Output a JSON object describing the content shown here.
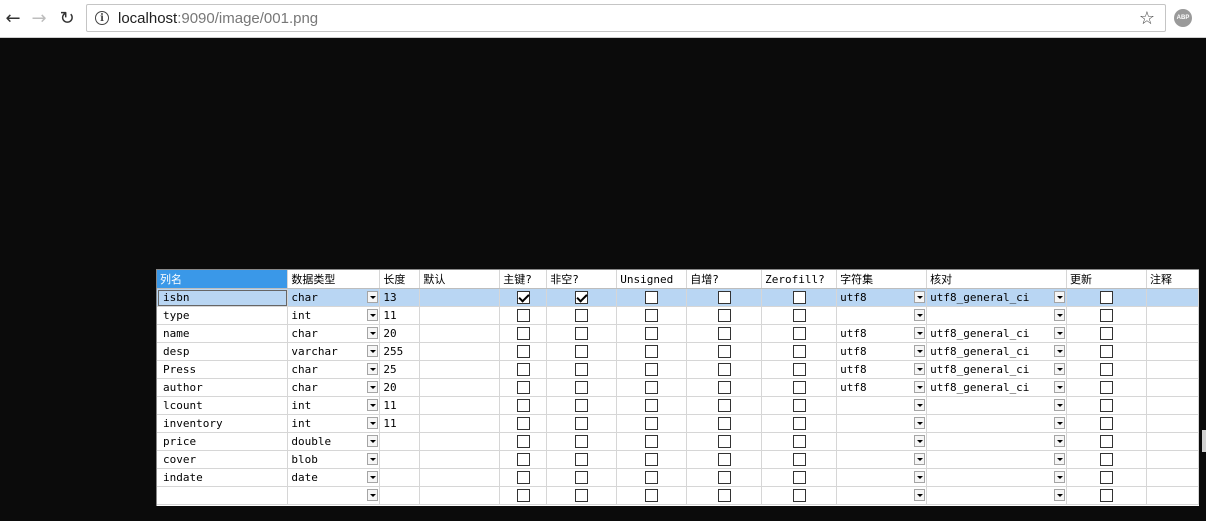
{
  "browser": {
    "url_host": "localhost",
    "url_rest": ":9090/image/001.png",
    "back_icon": "arrow-left-icon",
    "forward_icon": "arrow-right-icon",
    "reload_icon": "reload-icon",
    "info_icon": "info-icon",
    "bookmark_icon": "star-icon",
    "extension_label": "ABP"
  },
  "grid": {
    "headers": [
      "列名",
      "数据类型",
      "长度",
      "默认",
      "主键?",
      "非空?",
      "Unsigned",
      "自增?",
      "Zerofill?",
      "字符集",
      "核对",
      "更新",
      "注释"
    ],
    "rows": [
      {
        "name": "isbn",
        "type": "char",
        "length": "13",
        "default": "",
        "pk": true,
        "notnull": true,
        "unsigned": false,
        "autoinc": false,
        "zerofill": false,
        "charset": "utf8",
        "collation": "utf8_general_ci",
        "update": false,
        "comment": ""
      },
      {
        "name": "type",
        "type": "int",
        "length": "11",
        "default": "",
        "pk": false,
        "notnull": false,
        "unsigned": false,
        "autoinc": false,
        "zerofill": false,
        "charset": "",
        "collation": "",
        "update": false,
        "comment": ""
      },
      {
        "name": "name",
        "type": "char",
        "length": "20",
        "default": "",
        "pk": false,
        "notnull": false,
        "unsigned": false,
        "autoinc": false,
        "zerofill": false,
        "charset": "utf8",
        "collation": "utf8_general_ci",
        "update": false,
        "comment": ""
      },
      {
        "name": "desp",
        "type": "varchar",
        "length": "255",
        "default": "",
        "pk": false,
        "notnull": false,
        "unsigned": false,
        "autoinc": false,
        "zerofill": false,
        "charset": "utf8",
        "collation": "utf8_general_ci",
        "update": false,
        "comment": ""
      },
      {
        "name": "Press",
        "type": "char",
        "length": "25",
        "default": "",
        "pk": false,
        "notnull": false,
        "unsigned": false,
        "autoinc": false,
        "zerofill": false,
        "charset": "utf8",
        "collation": "utf8_general_ci",
        "update": false,
        "comment": ""
      },
      {
        "name": "author",
        "type": "char",
        "length": "20",
        "default": "",
        "pk": false,
        "notnull": false,
        "unsigned": false,
        "autoinc": false,
        "zerofill": false,
        "charset": "utf8",
        "collation": "utf8_general_ci",
        "update": false,
        "comment": ""
      },
      {
        "name": "lcount",
        "type": "int",
        "length": "11",
        "default": "",
        "pk": false,
        "notnull": false,
        "unsigned": false,
        "autoinc": false,
        "zerofill": false,
        "charset": "",
        "collation": "",
        "update": false,
        "comment": ""
      },
      {
        "name": "inventory",
        "type": "int",
        "length": "11",
        "default": "",
        "pk": false,
        "notnull": false,
        "unsigned": false,
        "autoinc": false,
        "zerofill": false,
        "charset": "",
        "collation": "",
        "update": false,
        "comment": ""
      },
      {
        "name": "price",
        "type": "double",
        "length": "",
        "default": "",
        "pk": false,
        "notnull": false,
        "unsigned": false,
        "autoinc": false,
        "zerofill": false,
        "charset": "",
        "collation": "",
        "update": false,
        "comment": ""
      },
      {
        "name": "cover",
        "type": "blob",
        "length": "",
        "default": "",
        "pk": false,
        "notnull": false,
        "unsigned": false,
        "autoinc": false,
        "zerofill": false,
        "charset": "",
        "collation": "",
        "update": false,
        "comment": ""
      },
      {
        "name": "indate",
        "type": "date",
        "length": "",
        "default": "",
        "pk": false,
        "notnull": false,
        "unsigned": false,
        "autoinc": false,
        "zerofill": false,
        "charset": "",
        "collation": "",
        "update": false,
        "comment": ""
      },
      {
        "name": "",
        "type": "",
        "length": "",
        "default": "",
        "pk": false,
        "notnull": false,
        "unsigned": false,
        "autoinc": false,
        "zerofill": false,
        "charset": "",
        "collation": "",
        "update": false,
        "comment": ""
      }
    ],
    "selected_row": 0,
    "colors": {
      "selected_header": "#3a98e8",
      "selected_row": "#b9d6f3",
      "background": "#0b0b0b"
    }
  }
}
